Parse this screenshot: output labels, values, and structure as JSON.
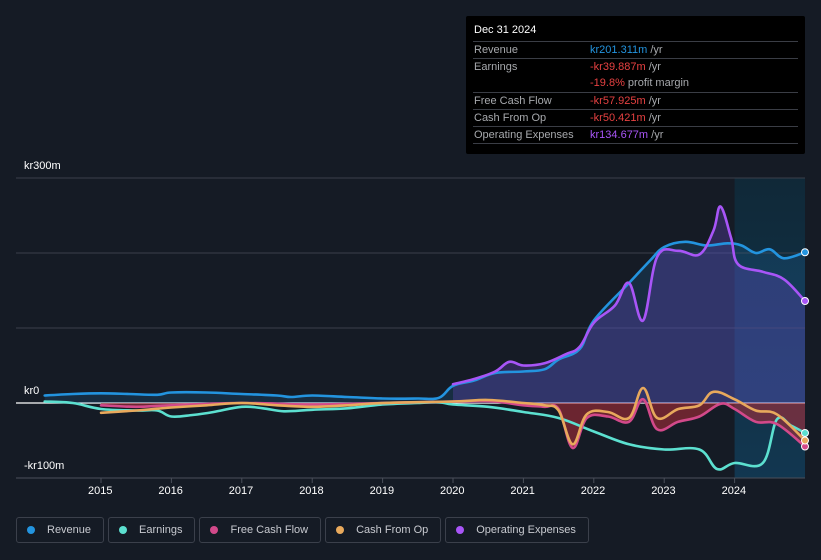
{
  "tooltip": {
    "date": "Dec 31 2024",
    "rows": [
      {
        "label": "Revenue",
        "value": "kr201.311m",
        "unit": " /yr",
        "color": "#2394df"
      },
      {
        "label": "Earnings",
        "value": "-kr39.887m",
        "unit": " /yr",
        "color": "#e64141"
      },
      {
        "label": "",
        "value": "-19.8%",
        "unit": " profit margin",
        "color": "#e64141"
      },
      {
        "label": "Free Cash Flow",
        "value": "-kr57.925m",
        "unit": " /yr",
        "color": "#e64141"
      },
      {
        "label": "Cash From Op",
        "value": "-kr50.421m",
        "unit": " /yr",
        "color": "#e64141"
      },
      {
        "label": "Operating Expenses",
        "value": "kr134.677m",
        "unit": " /yr",
        "color": "#a855f7"
      }
    ]
  },
  "chart_data": {
    "type": "line",
    "title": "",
    "xlabel": "",
    "ylabel": "",
    "y_tick_labels": [
      "kr300m",
      "kr0",
      "-kr100m"
    ],
    "y_ticks": [
      300,
      0,
      -100
    ],
    "ylim": [
      -100,
      300
    ],
    "xlim": [
      2014.2,
      2025.0
    ],
    "x_tick_labels": [
      "2015",
      "2016",
      "2017",
      "2018",
      "2019",
      "2020",
      "2021",
      "2022",
      "2023",
      "2024"
    ],
    "x_ticks": [
      2015,
      2016,
      2017,
      2018,
      2019,
      2020,
      2021,
      2022,
      2023,
      2024
    ],
    "gridlines": [
      300,
      200,
      100
    ],
    "highlight_range": [
      2024.0,
      2025.0
    ],
    "legend_position": "bottom-left",
    "units": "kr millions",
    "series": [
      {
        "name": "Revenue",
        "color": "#2394df",
        "fill": true,
        "points": [
          [
            2014.2,
            10
          ],
          [
            2014.6,
            12
          ],
          [
            2015,
            13
          ],
          [
            2015.4,
            12
          ],
          [
            2015.8,
            11
          ],
          [
            2016,
            14
          ],
          [
            2016.5,
            14
          ],
          [
            2017,
            12
          ],
          [
            2017.5,
            10
          ],
          [
            2017.7,
            8
          ],
          [
            2018,
            10
          ],
          [
            2018.5,
            8
          ],
          [
            2019,
            6
          ],
          [
            2019.5,
            6
          ],
          [
            2019.8,
            7
          ],
          [
            2020,
            23
          ],
          [
            2020.3,
            30
          ],
          [
            2020.6,
            40
          ],
          [
            2021,
            42
          ],
          [
            2021.3,
            45
          ],
          [
            2021.5,
            58
          ],
          [
            2021.8,
            72
          ],
          [
            2022,
            110
          ],
          [
            2022.5,
            160
          ],
          [
            2022.8,
            190
          ],
          [
            2023,
            208
          ],
          [
            2023.3,
            215
          ],
          [
            2023.6,
            210
          ],
          [
            2023.9,
            213
          ],
          [
            2024.1,
            210
          ],
          [
            2024.3,
            200
          ],
          [
            2024.5,
            205
          ],
          [
            2024.7,
            193
          ],
          [
            2025,
            201
          ]
        ]
      },
      {
        "name": "Earnings",
        "color": "#5ce0d0",
        "fill": false,
        "points": [
          [
            2014.2,
            2
          ],
          [
            2014.6,
            0
          ],
          [
            2015,
            -8
          ],
          [
            2015.5,
            -10
          ],
          [
            2015.8,
            -10
          ],
          [
            2016,
            -18
          ],
          [
            2016.3,
            -16
          ],
          [
            2016.6,
            -12
          ],
          [
            2017,
            -5
          ],
          [
            2017.3,
            -7
          ],
          [
            2017.6,
            -11
          ],
          [
            2018,
            -9
          ],
          [
            2018.5,
            -7
          ],
          [
            2019,
            -2
          ],
          [
            2019.5,
            0
          ],
          [
            2019.8,
            1
          ],
          [
            2020,
            -2
          ],
          [
            2020.5,
            -5
          ],
          [
            2021,
            -12
          ],
          [
            2021.5,
            -20
          ],
          [
            2022,
            -38
          ],
          [
            2022.5,
            -55
          ],
          [
            2023,
            -62
          ],
          [
            2023.5,
            -62
          ],
          [
            2023.75,
            -88
          ],
          [
            2024,
            -80
          ],
          [
            2024.4,
            -80
          ],
          [
            2024.6,
            -22
          ],
          [
            2024.8,
            -30
          ],
          [
            2025,
            -40
          ]
        ]
      },
      {
        "name": "Free Cash Flow",
        "color": "#d2498a",
        "fill": true,
        "points": [
          [
            2015,
            -3
          ],
          [
            2015.5,
            -5
          ],
          [
            2016,
            -3
          ],
          [
            2017,
            0
          ],
          [
            2018,
            -2
          ],
          [
            2019,
            0
          ],
          [
            2020,
            2
          ],
          [
            2020.5,
            3
          ],
          [
            2021,
            -3
          ],
          [
            2021.3,
            -5
          ],
          [
            2021.5,
            -8
          ],
          [
            2021.7,
            -60
          ],
          [
            2021.9,
            -20
          ],
          [
            2022.2,
            -18
          ],
          [
            2022.5,
            -25
          ],
          [
            2022.7,
            5
          ],
          [
            2022.9,
            -35
          ],
          [
            2023.2,
            -25
          ],
          [
            2023.5,
            -18
          ],
          [
            2023.8,
            -1
          ],
          [
            2024,
            -8
          ],
          [
            2024.3,
            -25
          ],
          [
            2024.6,
            -28
          ],
          [
            2025,
            -58
          ]
        ]
      },
      {
        "name": "Cash From Op",
        "color": "#e8a95c",
        "fill": false,
        "points": [
          [
            2015,
            -13
          ],
          [
            2015.5,
            -10
          ],
          [
            2016,
            -6
          ],
          [
            2016.5,
            -3
          ],
          [
            2017,
            0
          ],
          [
            2017.5,
            -3
          ],
          [
            2018,
            -5
          ],
          [
            2018.5,
            -3
          ],
          [
            2019,
            0
          ],
          [
            2020,
            2
          ],
          [
            2020.5,
            4
          ],
          [
            2021,
            0
          ],
          [
            2021.3,
            -3
          ],
          [
            2021.5,
            -10
          ],
          [
            2021.7,
            -55
          ],
          [
            2021.9,
            -15
          ],
          [
            2022.2,
            -12
          ],
          [
            2022.5,
            -20
          ],
          [
            2022.7,
            20
          ],
          [
            2022.9,
            -20
          ],
          [
            2023.2,
            -8
          ],
          [
            2023.5,
            -3
          ],
          [
            2023.7,
            15
          ],
          [
            2024,
            5
          ],
          [
            2024.3,
            -10
          ],
          [
            2024.6,
            -15
          ],
          [
            2025,
            -50
          ]
        ]
      },
      {
        "name": "Operating Expenses",
        "color": "#a855f7",
        "fill": true,
        "points": [
          [
            2020,
            25
          ],
          [
            2020.3,
            32
          ],
          [
            2020.6,
            42
          ],
          [
            2020.8,
            55
          ],
          [
            2021,
            50
          ],
          [
            2021.3,
            53
          ],
          [
            2021.6,
            65
          ],
          [
            2021.8,
            75
          ],
          [
            2022,
            107
          ],
          [
            2022.3,
            130
          ],
          [
            2022.5,
            160
          ],
          [
            2022.7,
            110
          ],
          [
            2022.9,
            195
          ],
          [
            2023.2,
            203
          ],
          [
            2023.5,
            198
          ],
          [
            2023.7,
            230
          ],
          [
            2023.8,
            262
          ],
          [
            2023.95,
            220
          ],
          [
            2024.05,
            185
          ],
          [
            2024.4,
            175
          ],
          [
            2024.7,
            165
          ],
          [
            2025,
            136
          ]
        ]
      }
    ]
  },
  "legend": [
    {
      "label": "Revenue",
      "color": "#2394df"
    },
    {
      "label": "Earnings",
      "color": "#5ce0d0"
    },
    {
      "label": "Free Cash Flow",
      "color": "#d2498a"
    },
    {
      "label": "Cash From Op",
      "color": "#e8a95c"
    },
    {
      "label": "Operating Expenses",
      "color": "#a855f7"
    }
  ]
}
